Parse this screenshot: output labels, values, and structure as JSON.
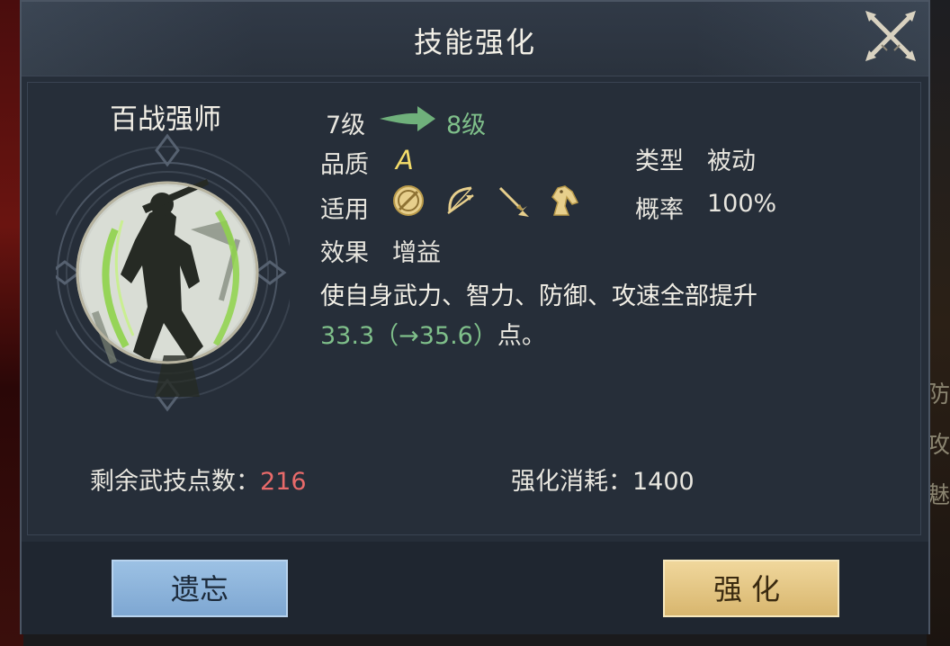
{
  "dialog": {
    "title": "技能强化",
    "close_icon": "crossed-swords-close-icon"
  },
  "skill": {
    "name": "百战强师",
    "icon": "warrior-silhouette-skill-icon",
    "level_from": "7级",
    "level_to": "8级",
    "quality_label": "品质",
    "quality_value": "A",
    "type_label": "类型",
    "type_value": "被动",
    "applicable_label": "适用",
    "applicable_units": [
      "shield-icon",
      "bow-icon",
      "spear-icon",
      "horse-icon"
    ],
    "chance_label": "概率",
    "chance_value": "100%",
    "effect_label": "效果",
    "effect_value": "增益",
    "description_line1": "使自身武力、智力、防御、攻速全部提升",
    "description_value": "33.3（→35.6）",
    "description_suffix": "点。"
  },
  "stats": {
    "remaining_label": "剩余武技点数：",
    "remaining_value": "216",
    "cost_label": "强化消耗：",
    "cost_value": "1400"
  },
  "buttons": {
    "forget": "遗忘",
    "upgrade": "强化"
  },
  "background": {
    "right_edge_chars": [
      "防",
      "攻",
      "魅"
    ]
  },
  "colors": {
    "accent_green": "#7fbf8a",
    "remaining_red": "#e86a6a",
    "quality_gold": "#f4dc6a"
  }
}
